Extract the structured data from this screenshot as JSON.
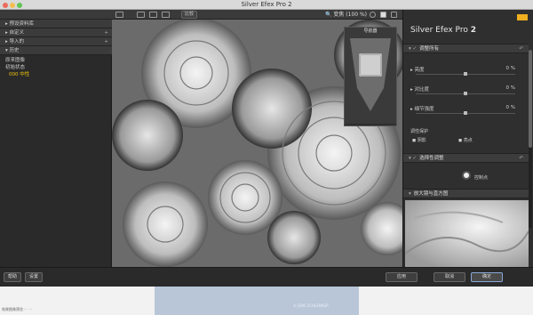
{
  "window": {
    "title": "Silver Efex Pro 2"
  },
  "toolbar": {
    "compare_label": "比较",
    "zoom": "🔍 变焦 (100 %)"
  },
  "left_panel": {
    "sections": [
      {
        "label": "▸ 预设资料库"
      },
      {
        "label": "▸ 自定义"
      },
      {
        "label": "▸ 导入的"
      },
      {
        "label": "▾ 历史"
      }
    ],
    "history_items": [
      "原来图像",
      "初始状态",
      "000 中性"
    ]
  },
  "navigator": {
    "title": "导航器"
  },
  "right_panel": {
    "logo_prefix": "Silver Efex Pro",
    "logo_version": "2",
    "global": {
      "header": "调整所有",
      "sliders": [
        {
          "label": "亮度",
          "value": "0 %",
          "level": 0.5
        },
        {
          "label": "对比度",
          "value": "0 %",
          "level": 0.5
        },
        {
          "label": "细节强度",
          "value": "0 %",
          "level": 0.5
        }
      ],
      "tone_protection": "调性保护",
      "shadows": "阴影",
      "highlights": "亮点"
    },
    "selective": {
      "header": "选择性调整",
      "control_point": "控制点"
    },
    "loupe": {
      "header": "放大镜与直方图"
    }
  },
  "bottom_bar": {
    "help": "帮助",
    "settings": "设置",
    "apply": "应用",
    "cancel": "取消",
    "ok": "确定"
  },
  "thumbnail": {
    "watermark": "© JENS SCHLENKER"
  },
  "caption": {
    "text": "效果图像预览 - · · ·"
  }
}
